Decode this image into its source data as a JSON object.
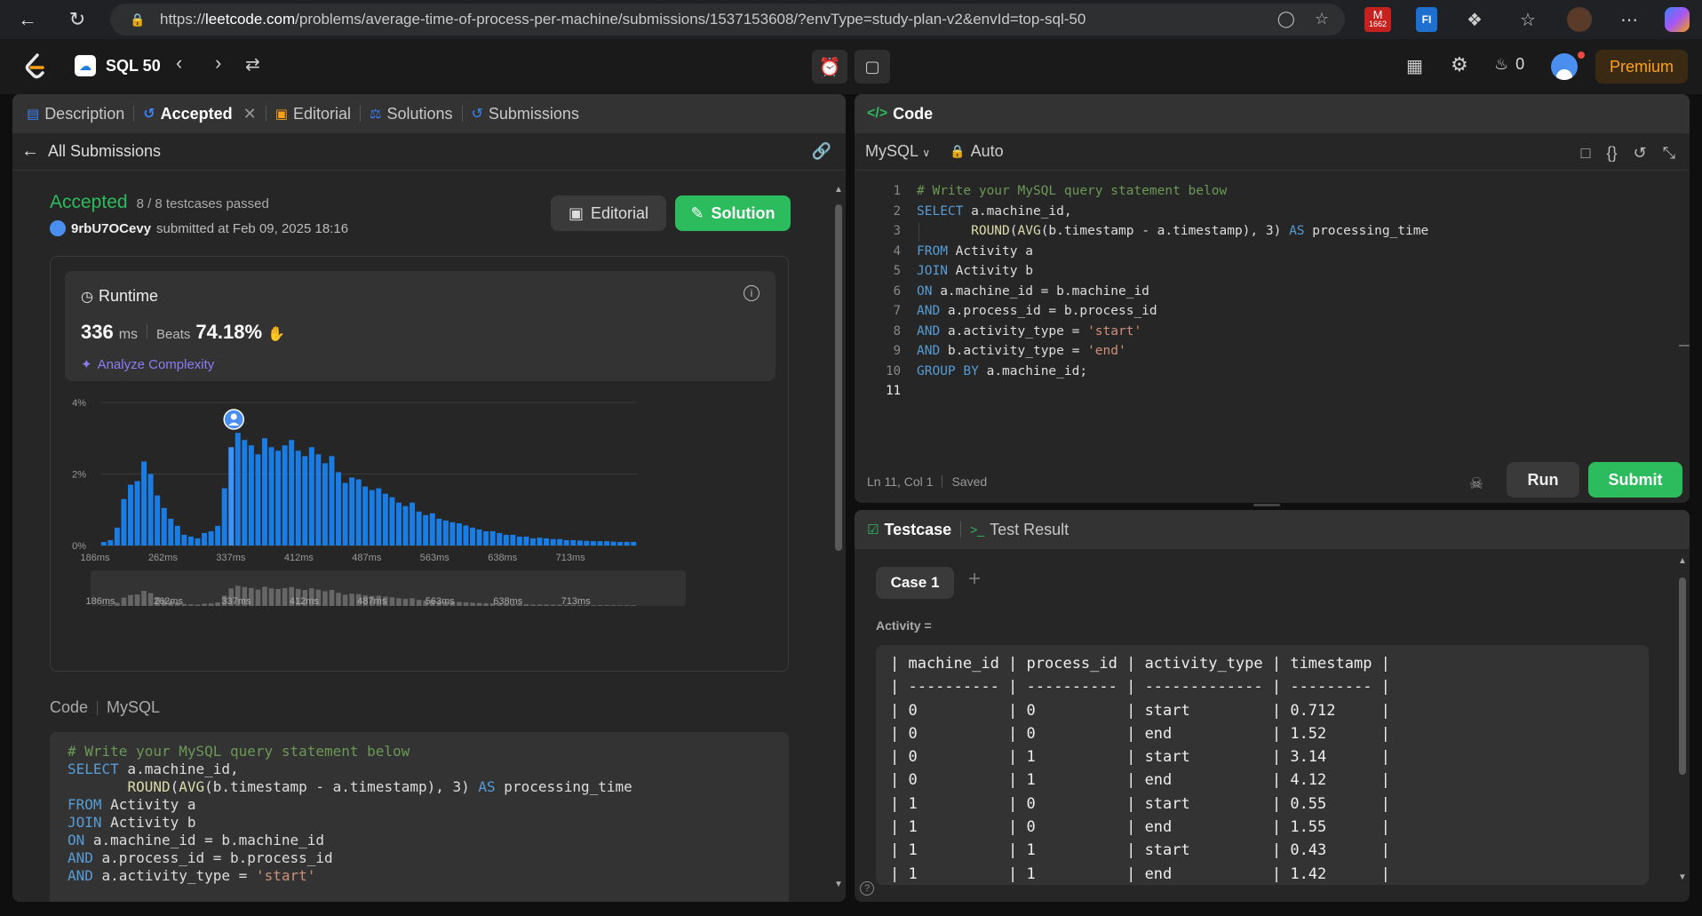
{
  "browser": {
    "url_host": "leetcode.com",
    "url_prefix": "https://",
    "url_path": "/problems/average-time-of-process-per-machine/submissions/1537153608/?envType=study-plan-v2&envId=top-sql-50",
    "mail_badge": "1662",
    "ext_fi": "FI"
  },
  "nav": {
    "study_plan": "SQL 50",
    "streak_count": "0",
    "premium": "Premium"
  },
  "left_tabs": {
    "description": "Description",
    "accepted": "Accepted",
    "editorial": "Editorial",
    "solutions": "Solutions",
    "submissions": "Submissions"
  },
  "submission": {
    "back_label": "All Submissions",
    "status": "Accepted",
    "testcases": "8 / 8 testcases passed",
    "user": "9rbU7OCevy",
    "submitted_at": "submitted at Feb 09, 2025 18:16",
    "editorial_btn": "Editorial",
    "solution_btn": "Solution"
  },
  "runtime": {
    "label": "Runtime",
    "value": "336",
    "unit": "ms",
    "beats_label": "Beats",
    "beats_value": "74.18%",
    "analyze": "Analyze Complexity"
  },
  "chart_data": {
    "type": "bar",
    "ylabel": "",
    "y_ticks": [
      "4%",
      "2%",
      "0%"
    ],
    "ylim": [
      0,
      4
    ],
    "x_ticks": [
      "186ms",
      "262ms",
      "337ms",
      "412ms",
      "487ms",
      "563ms",
      "638ms",
      "713ms"
    ],
    "user_marker": "336ms",
    "values": [
      0.1,
      0.15,
      0.5,
      1.3,
      1.7,
      1.8,
      2.35,
      2.0,
      1.4,
      1.05,
      0.75,
      0.55,
      0.3,
      0.25,
      0.2,
      0.35,
      0.4,
      0.55,
      1.6,
      2.75,
      3.15,
      2.95,
      2.8,
      2.55,
      3.0,
      2.75,
      2.65,
      2.8,
      2.95,
      2.65,
      2.5,
      2.75,
      2.55,
      2.3,
      2.5,
      2.05,
      1.75,
      1.9,
      1.85,
      1.65,
      1.55,
      1.6,
      1.45,
      1.35,
      1.2,
      1.1,
      1.2,
      0.95,
      0.85,
      0.9,
      0.75,
      0.7,
      0.65,
      0.62,
      0.56,
      0.5,
      0.45,
      0.4,
      0.4,
      0.35,
      0.3,
      0.3,
      0.25,
      0.25,
      0.2,
      0.22,
      0.2,
      0.18,
      0.18,
      0.15,
      0.15,
      0.14,
      0.13,
      0.12,
      0.12,
      0.12,
      0.11,
      0.1,
      0.1,
      0.1
    ],
    "highlight_index": 19
  },
  "code_section": {
    "label": "Code",
    "lang": "MySQL"
  },
  "editor": {
    "title": "Code",
    "lang": "MySQL",
    "mode": "Auto",
    "status_pos": "Ln 11, Col 1",
    "status_saved": "Saved",
    "run": "Run",
    "submit": "Submit",
    "line_numbers": [
      "1",
      "2",
      "3",
      "4",
      "5",
      "6",
      "7",
      "8",
      "9",
      "10",
      "11"
    ]
  },
  "code_lines": [
    "# Write your MySQL query statement below",
    "SELECT a.machine_id,",
    "       ROUND(AVG(b.timestamp - a.timestamp), 3) AS processing_time",
    "FROM Activity a",
    "JOIN Activity b",
    "ON a.machine_id = b.machine_id",
    "AND a.process_id = b.process_id",
    "AND a.activity_type = 'start'",
    "AND b.activity_type = 'end'",
    "GROUP BY a.machine_id;",
    ""
  ],
  "testcase": {
    "tab_testcase": "Testcase",
    "tab_result": "Test Result",
    "case_label": "Case 1",
    "input_name": "Activity =",
    "table_lines": [
      "| machine_id | process_id | activity_type | timestamp |",
      "| ---------- | ---------- | ------------- | --------- |",
      "| 0          | 0          | start         | 0.712     |",
      "| 0          | 0          | end           | 1.52      |",
      "| 0          | 1          | start         | 3.14      |",
      "| 0          | 1          | end           | 4.12      |",
      "| 1          | 0          | start         | 0.55      |",
      "| 1          | 0          | end           | 1.55      |",
      "| 1          | 1          | start         | 0.43      |",
      "| 1          | 1          | end           | 1.42      |"
    ]
  },
  "colors": {
    "accepted": "#2cbb5d",
    "bar": "#1a7de6",
    "bar_highlight": "#3a94ff",
    "premium": "#ffa116",
    "submit": "#2cbb5d"
  }
}
